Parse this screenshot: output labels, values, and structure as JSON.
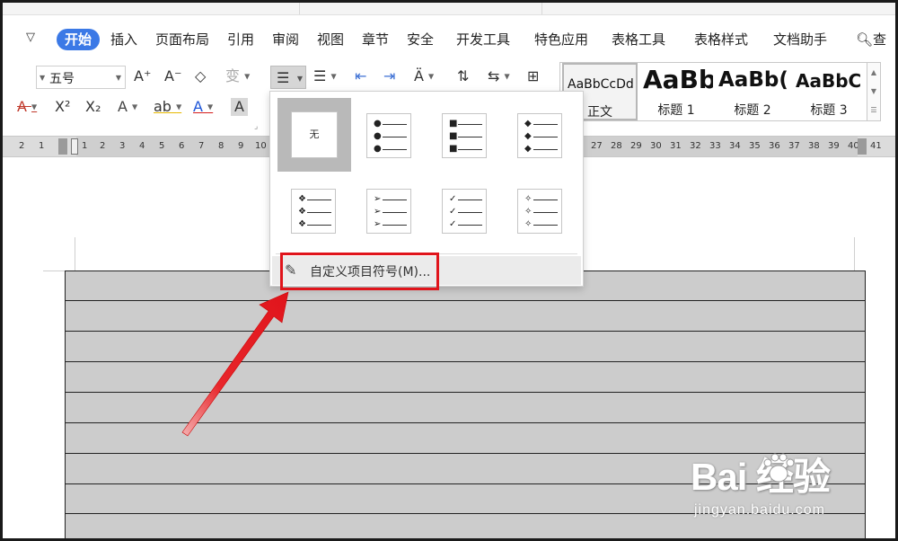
{
  "menu": {
    "items": [
      "开始",
      "插入",
      "页面布局",
      "引用",
      "审阅",
      "视图",
      "章节",
      "安全",
      "开发工具",
      "特色应用",
      "表格工具",
      "表格样式",
      "文档助手"
    ],
    "search_label": "查"
  },
  "ribbon": {
    "font_size": "五号",
    "grow_font": "A⁺",
    "shrink_font": "A⁻",
    "clear_format": "◇",
    "phonetic": "变",
    "strikethrough": "A",
    "superscript": "X²",
    "subscript": "X₂",
    "outline_text": "A",
    "highlight": "ab",
    "font_color": "A",
    "char_shading": "A"
  },
  "styles": [
    {
      "sample": "AaBbCcDd",
      "name": "正文"
    },
    {
      "sample": "AaBb",
      "name": "标题 1"
    },
    {
      "sample": "AaBb(",
      "name": "标题 2"
    },
    {
      "sample": "AaBbC",
      "name": "标题 3"
    }
  ],
  "ruler": {
    "left_ticks": [
      "2",
      "1",
      "1",
      "2",
      "3",
      "4",
      "5",
      "6",
      "7",
      "8",
      "9",
      "10"
    ],
    "right_ticks": [
      "27",
      "28",
      "29",
      "30",
      "31",
      "32",
      "33",
      "34",
      "35",
      "36",
      "37",
      "38",
      "39",
      "40",
      "41"
    ]
  },
  "bullet_menu": {
    "none_label": "无",
    "options": [
      "filled-circle",
      "filled-square",
      "filled-diamond",
      "four-diamond",
      "arrowhead",
      "checkmark",
      "hollow-diamond"
    ],
    "custom_label": "自定义项目符号(M)..."
  },
  "colors": {
    "accent": "#3b79e6",
    "highlight_red": "#e0141b",
    "table_fill": "#cccccc"
  },
  "watermark": {
    "logo": "Bai  经验",
    "sub": "jingyan.baidu.com"
  }
}
